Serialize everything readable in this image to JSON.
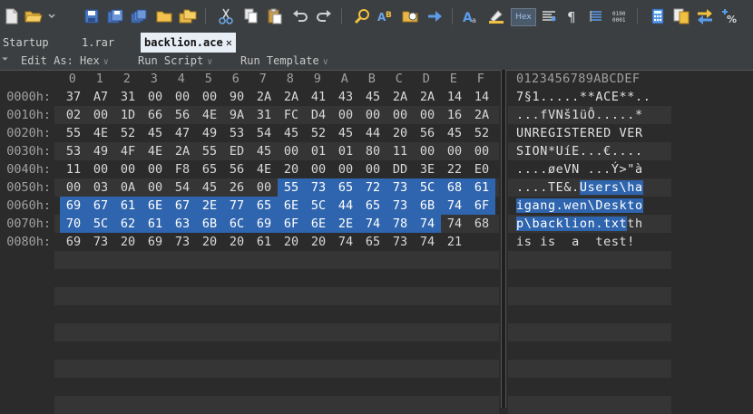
{
  "toolbar": {
    "hex_label": "Hex"
  },
  "tabs": [
    {
      "label": "Startup",
      "active": false
    },
    {
      "label": "1.rar",
      "active": false
    },
    {
      "label": "backlion.ace",
      "active": true,
      "close": "✕"
    }
  ],
  "menubar": {
    "edit_as": "Edit As: Hex",
    "run_script": "Run Script",
    "run_template": "Run Template",
    "menu_icon": "⏷"
  },
  "columns": [
    "0",
    "1",
    "2",
    "3",
    "4",
    "5",
    "6",
    "7",
    "8",
    "9",
    "A",
    "B",
    "C",
    "D",
    "E",
    "F"
  ],
  "ascii_header": "0123456789ABCDEF",
  "rows": [
    {
      "addr": "0000h:",
      "bytes": [
        "37",
        "A7",
        "31",
        "00",
        "00",
        "00",
        "90",
        "2A",
        "2A",
        "41",
        "43",
        "45",
        "2A",
        "2A",
        "14",
        "14"
      ],
      "ascii": "7§1.....**ACE**.."
    },
    {
      "addr": "0010h:",
      "bytes": [
        "02",
        "00",
        "1D",
        "66",
        "56",
        "4E",
        "9A",
        "31",
        "FC",
        "D4",
        "00",
        "00",
        "00",
        "00",
        "16",
        "2A"
      ],
      "ascii": "...fVNš1üÔ.....*"
    },
    {
      "addr": "0020h:",
      "bytes": [
        "55",
        "4E",
        "52",
        "45",
        "47",
        "49",
        "53",
        "54",
        "45",
        "52",
        "45",
        "44",
        "20",
        "56",
        "45",
        "52"
      ],
      "ascii": "UNREGISTERED VER"
    },
    {
      "addr": "0030h:",
      "bytes": [
        "53",
        "49",
        "4F",
        "4E",
        "2A",
        "55",
        "ED",
        "45",
        "00",
        "01",
        "01",
        "80",
        "11",
        "00",
        "00",
        "00"
      ],
      "ascii": "SION*UíE...€...."
    },
    {
      "addr": "0040h:",
      "bytes": [
        "11",
        "00",
        "00",
        "00",
        "F8",
        "65",
        "56",
        "4E",
        "20",
        "00",
        "00",
        "00",
        "DD",
        "3E",
        "22",
        "E0"
      ],
      "ascii": "....øeVN ...Ý>\"à"
    },
    {
      "addr": "0050h:",
      "bytes": [
        "00",
        "03",
        "0A",
        "00",
        "54",
        "45",
        "26",
        "00",
        "55",
        "73",
        "65",
        "72",
        "73",
        "5C",
        "68",
        "61"
      ],
      "ascii": "....TE&.Users\\ha"
    },
    {
      "addr": "0060h:",
      "bytes": [
        "69",
        "67",
        "61",
        "6E",
        "67",
        "2E",
        "77",
        "65",
        "6E",
        "5C",
        "44",
        "65",
        "73",
        "6B",
        "74",
        "6F"
      ],
      "ascii": "igang.wen\\Deskto"
    },
    {
      "addr": "0070h:",
      "bytes": [
        "70",
        "5C",
        "62",
        "61",
        "63",
        "6B",
        "6C",
        "69",
        "6F",
        "6E",
        "2E",
        "74",
        "78",
        "74",
        "74",
        "68"
      ],
      "ascii": "p\\backlion.txtth"
    },
    {
      "addr": "0080h:",
      "bytes": [
        "69",
        "73",
        "20",
        "69",
        "73",
        "20",
        "20",
        "61",
        "20",
        "20",
        "74",
        "65",
        "73",
        "74",
        "21"
      ],
      "ascii": "is is  a  test!"
    }
  ]
}
